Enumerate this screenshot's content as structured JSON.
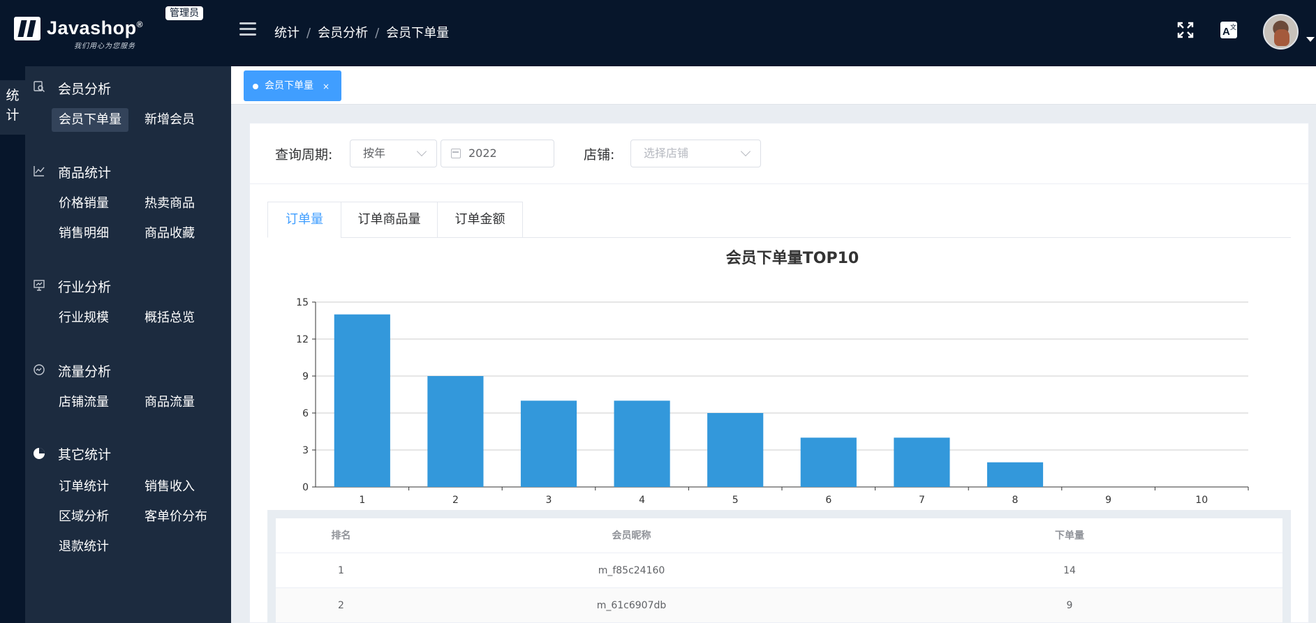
{
  "header": {
    "logo_text": "Javashop",
    "logo_reg": "®",
    "logo_slogan": "我们用心为您服务",
    "role_badge": "管理员",
    "breadcrumb": [
      "统计",
      "会员分析",
      "会员下单量"
    ],
    "icons": [
      "menu-icon",
      "fullscreen-icon",
      "translate-icon",
      "user-avatar",
      "caret-down-icon"
    ]
  },
  "rail": {
    "label_line1": "统",
    "label_line2": "计"
  },
  "sidebar": {
    "groups": [
      {
        "title": "会员分析",
        "icon": "member-analysis-icon",
        "items": [
          "会员下单量",
          "新增会员"
        ]
      },
      {
        "title": "商品统计",
        "icon": "chart-line-icon",
        "items": [
          "价格销量",
          "热卖商品",
          "销售明细",
          "商品收藏"
        ]
      },
      {
        "title": "行业分析",
        "icon": "presentation-icon",
        "items": [
          "行业规模",
          "概括总览"
        ]
      },
      {
        "title": "流量分析",
        "icon": "traffic-icon",
        "items": [
          "店铺流量",
          "商品流量"
        ]
      },
      {
        "title": "其它统计",
        "icon": "pie-icon",
        "items": [
          "订单统计",
          "销售收入",
          "区域分析",
          "客单价分布",
          "退款统计"
        ]
      }
    ],
    "active_item": "会员下单量"
  },
  "page_tab": {
    "label": "会员下单量",
    "close": "×"
  },
  "filters": {
    "period_label": "查询周期:",
    "period_value": "按年",
    "year_value": "2022",
    "shop_label": "店铺:",
    "shop_placeholder": "选择店铺"
  },
  "tabs": [
    "订单量",
    "订单商品量",
    "订单金额"
  ],
  "active_tab": "订单量",
  "accent_color": "#409eff",
  "bar_color": "#3398db",
  "chart_data": {
    "type": "bar",
    "title": "会员下单量TOP10",
    "categories": [
      "1",
      "2",
      "3",
      "4",
      "5",
      "6",
      "7",
      "8",
      "9",
      "10"
    ],
    "values": [
      14,
      9,
      7,
      7,
      6,
      4,
      4,
      2,
      0,
      0
    ],
    "ylim": [
      0,
      15
    ],
    "yticks": [
      "0",
      "3",
      "6",
      "9",
      "12",
      "15"
    ],
    "grid": true,
    "xlabel": "",
    "ylabel": ""
  },
  "table": {
    "headers": [
      "排名",
      "会员昵称",
      "下单量"
    ],
    "rows": [
      [
        "1",
        "m_f85c24160",
        "14"
      ],
      [
        "2",
        "m_61c6907db",
        "9"
      ]
    ]
  }
}
